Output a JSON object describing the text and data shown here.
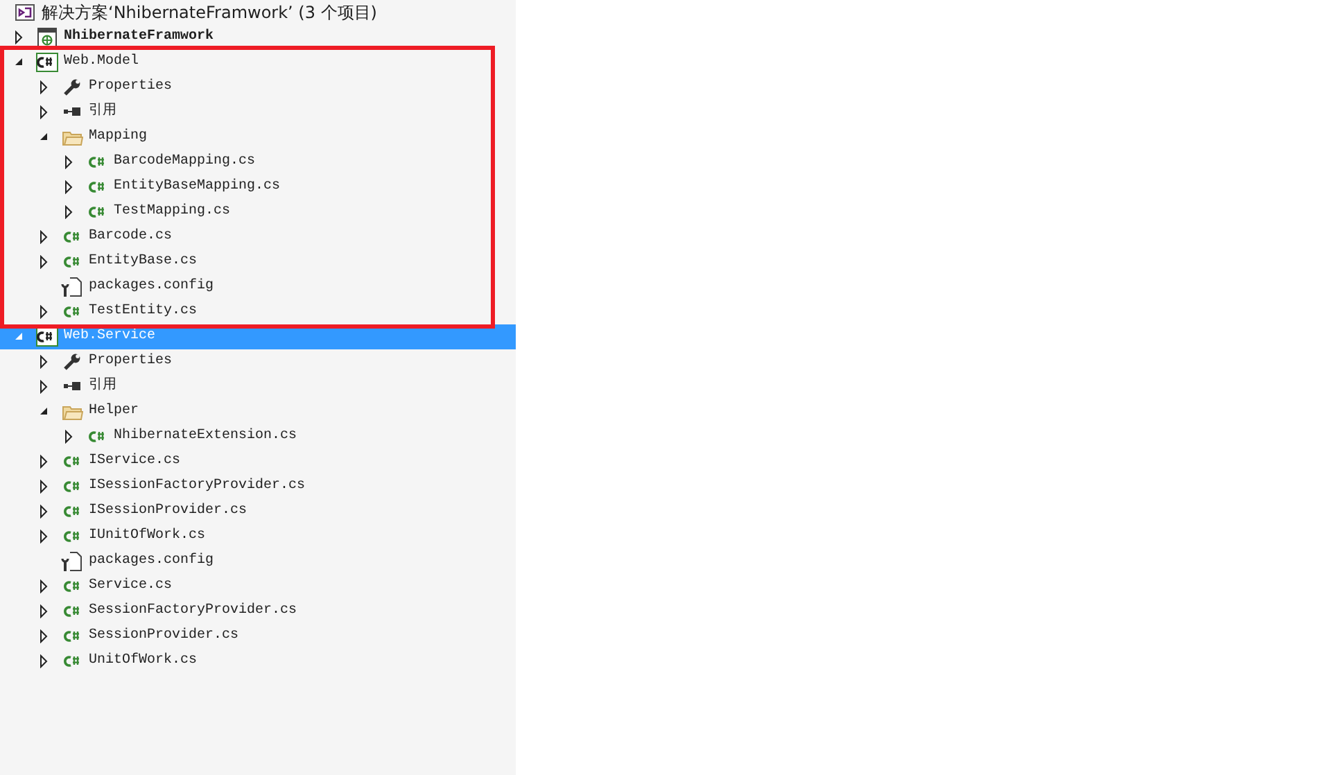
{
  "tree": [
    {
      "kind": "solution",
      "label": "解决方案‘NhibernateFramwork’ (3 个项目)",
      "children": [
        {
          "kind": "project-web",
          "label": "NhibernateFramwork",
          "expanded": false,
          "startup": true,
          "selected": false
        },
        {
          "kind": "project",
          "label": "Web.Model",
          "expanded": true,
          "startup": false,
          "selected": false,
          "highlighted": true,
          "children": [
            {
              "kind": "properties",
              "label": "Properties",
              "expanded": false
            },
            {
              "kind": "references",
              "label": "引用",
              "expanded": false
            },
            {
              "kind": "folder",
              "label": "Mapping",
              "expanded": true,
              "children": [
                {
                  "kind": "cs",
                  "label": "BarcodeMapping.cs",
                  "expanded": false
                },
                {
                  "kind": "cs",
                  "label": "EntityBaseMapping.cs",
                  "expanded": false
                },
                {
                  "kind": "cs",
                  "label": "TestMapping.cs",
                  "expanded": false
                }
              ]
            },
            {
              "kind": "cs",
              "label": "Barcode.cs",
              "expanded": false
            },
            {
              "kind": "cs",
              "label": "EntityBase.cs",
              "expanded": false
            },
            {
              "kind": "config",
              "label": "packages.config"
            },
            {
              "kind": "cs",
              "label": "TestEntity.cs",
              "expanded": false
            }
          ]
        },
        {
          "kind": "project",
          "label": "Web.Service",
          "expanded": true,
          "startup": false,
          "selected": true,
          "highlighted": false,
          "children": [
            {
              "kind": "properties",
              "label": "Properties",
              "expanded": false
            },
            {
              "kind": "references",
              "label": "引用",
              "expanded": false
            },
            {
              "kind": "folder",
              "label": "Helper",
              "expanded": true,
              "children": [
                {
                  "kind": "cs",
                  "label": "NhibernateExtension.cs",
                  "expanded": false
                }
              ]
            },
            {
              "kind": "cs",
              "label": "IService.cs",
              "expanded": false
            },
            {
              "kind": "cs",
              "label": "ISessionFactoryProvider.cs",
              "expanded": false
            },
            {
              "kind": "cs",
              "label": "ISessionProvider.cs",
              "expanded": false
            },
            {
              "kind": "cs",
              "label": "IUnitOfWork.cs",
              "expanded": false
            },
            {
              "kind": "config",
              "label": "packages.config"
            },
            {
              "kind": "cs",
              "label": "Service.cs",
              "expanded": false
            },
            {
              "kind": "cs",
              "label": "SessionFactoryProvider.cs",
              "expanded": false
            },
            {
              "kind": "cs",
              "label": "SessionProvider.cs",
              "expanded": false
            },
            {
              "kind": "cs",
              "label": "UnitOfWork.cs",
              "expanded": false
            }
          ]
        }
      ]
    }
  ]
}
